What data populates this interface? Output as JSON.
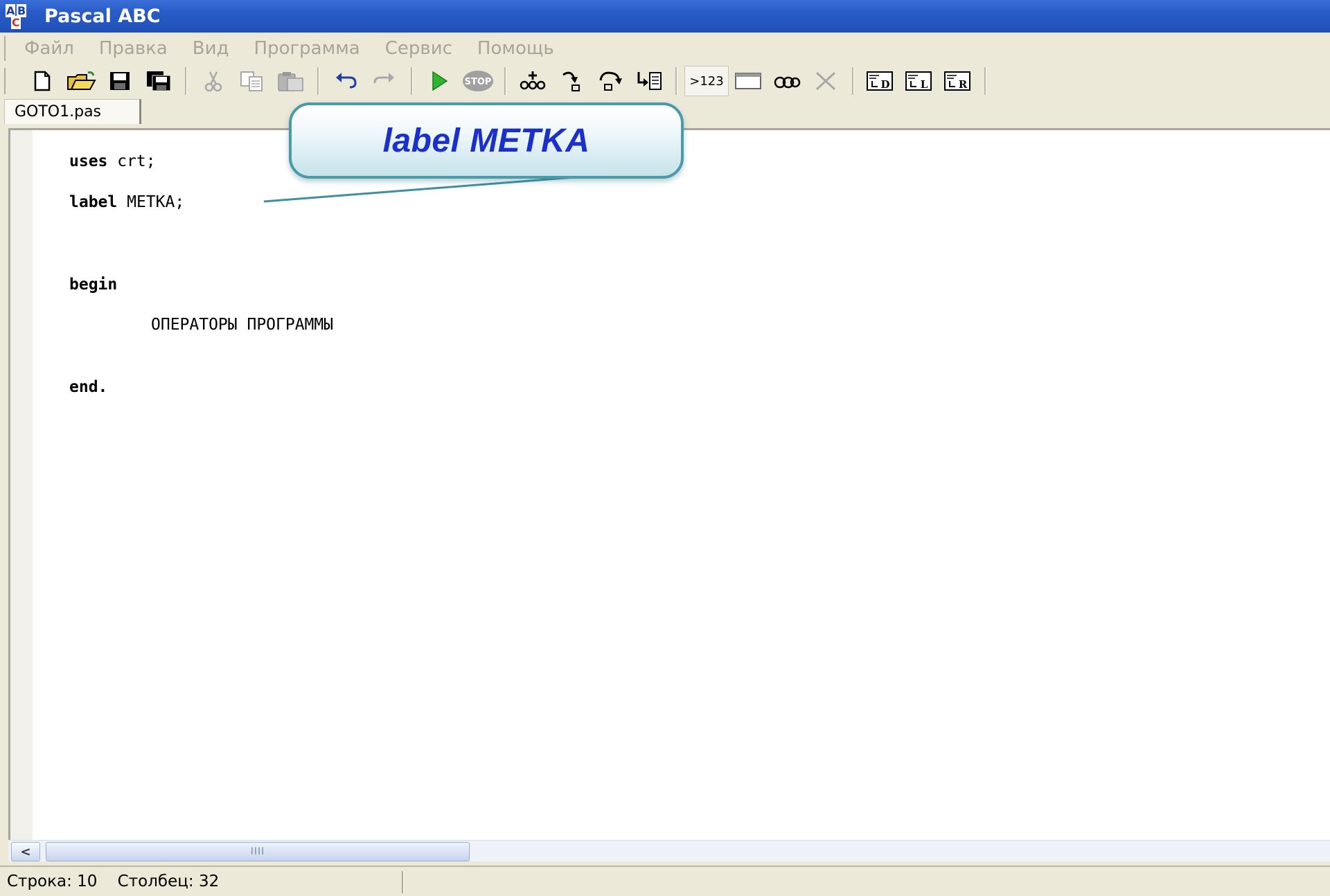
{
  "window": {
    "title": "Pascal ABC",
    "icon_letters": {
      "a": "A",
      "b": "B",
      "c": "C"
    }
  },
  "menu": {
    "items": [
      "Файл",
      "Правка",
      "Вид",
      "Программа",
      "Сервис",
      "Помощь"
    ]
  },
  "toolbar": {
    "buttons": [
      {
        "name": "new-file-icon"
      },
      {
        "name": "open-folder-icon"
      },
      {
        "name": "save-icon"
      },
      {
        "name": "save-all-icon"
      },
      {
        "name": "cut-icon",
        "disabled": true
      },
      {
        "name": "copy-icon",
        "disabled": true
      },
      {
        "name": "paste-icon",
        "disabled": true
      },
      {
        "name": "undo-icon"
      },
      {
        "name": "redo-icon",
        "disabled": true
      },
      {
        "name": "run-icon"
      },
      {
        "name": "stop-icon",
        "disabled": true
      },
      {
        "name": "breakpoint-icon"
      },
      {
        "name": "step-into-icon"
      },
      {
        "name": "step-over-icon"
      },
      {
        "name": "run-to-cursor-icon"
      },
      {
        "name": "output-icon",
        "label": ">123"
      },
      {
        "name": "window-icon"
      },
      {
        "name": "watch-icon"
      },
      {
        "name": "clear-icon"
      },
      {
        "name": "format-d-icon",
        "label": "D"
      },
      {
        "name": "format-l-icon",
        "label": "L"
      },
      {
        "name": "format-r-icon",
        "label": "R"
      }
    ]
  },
  "tabs": [
    {
      "label": "GOTO1.pas"
    }
  ],
  "editor": {
    "lines": {
      "uses_kw": "uses",
      "uses_rest": " crt;",
      "label_kw": "label",
      "label_rest": " METKA;",
      "begin_kw": "begin",
      "statements": "ОПЕРАТОРЫ ПРОГРАММЫ",
      "end_kw": "end."
    }
  },
  "callout": {
    "text": "label METKA"
  },
  "scrollbar": {
    "left_arrow": "<",
    "thumb_grip": "IIII"
  },
  "status": {
    "text": "Строка: 10    Столбец: 32"
  },
  "colors": {
    "titlebar": "#2456c0",
    "callout_text": "#1a2fcc",
    "callout_border": "#4a9aa8"
  }
}
